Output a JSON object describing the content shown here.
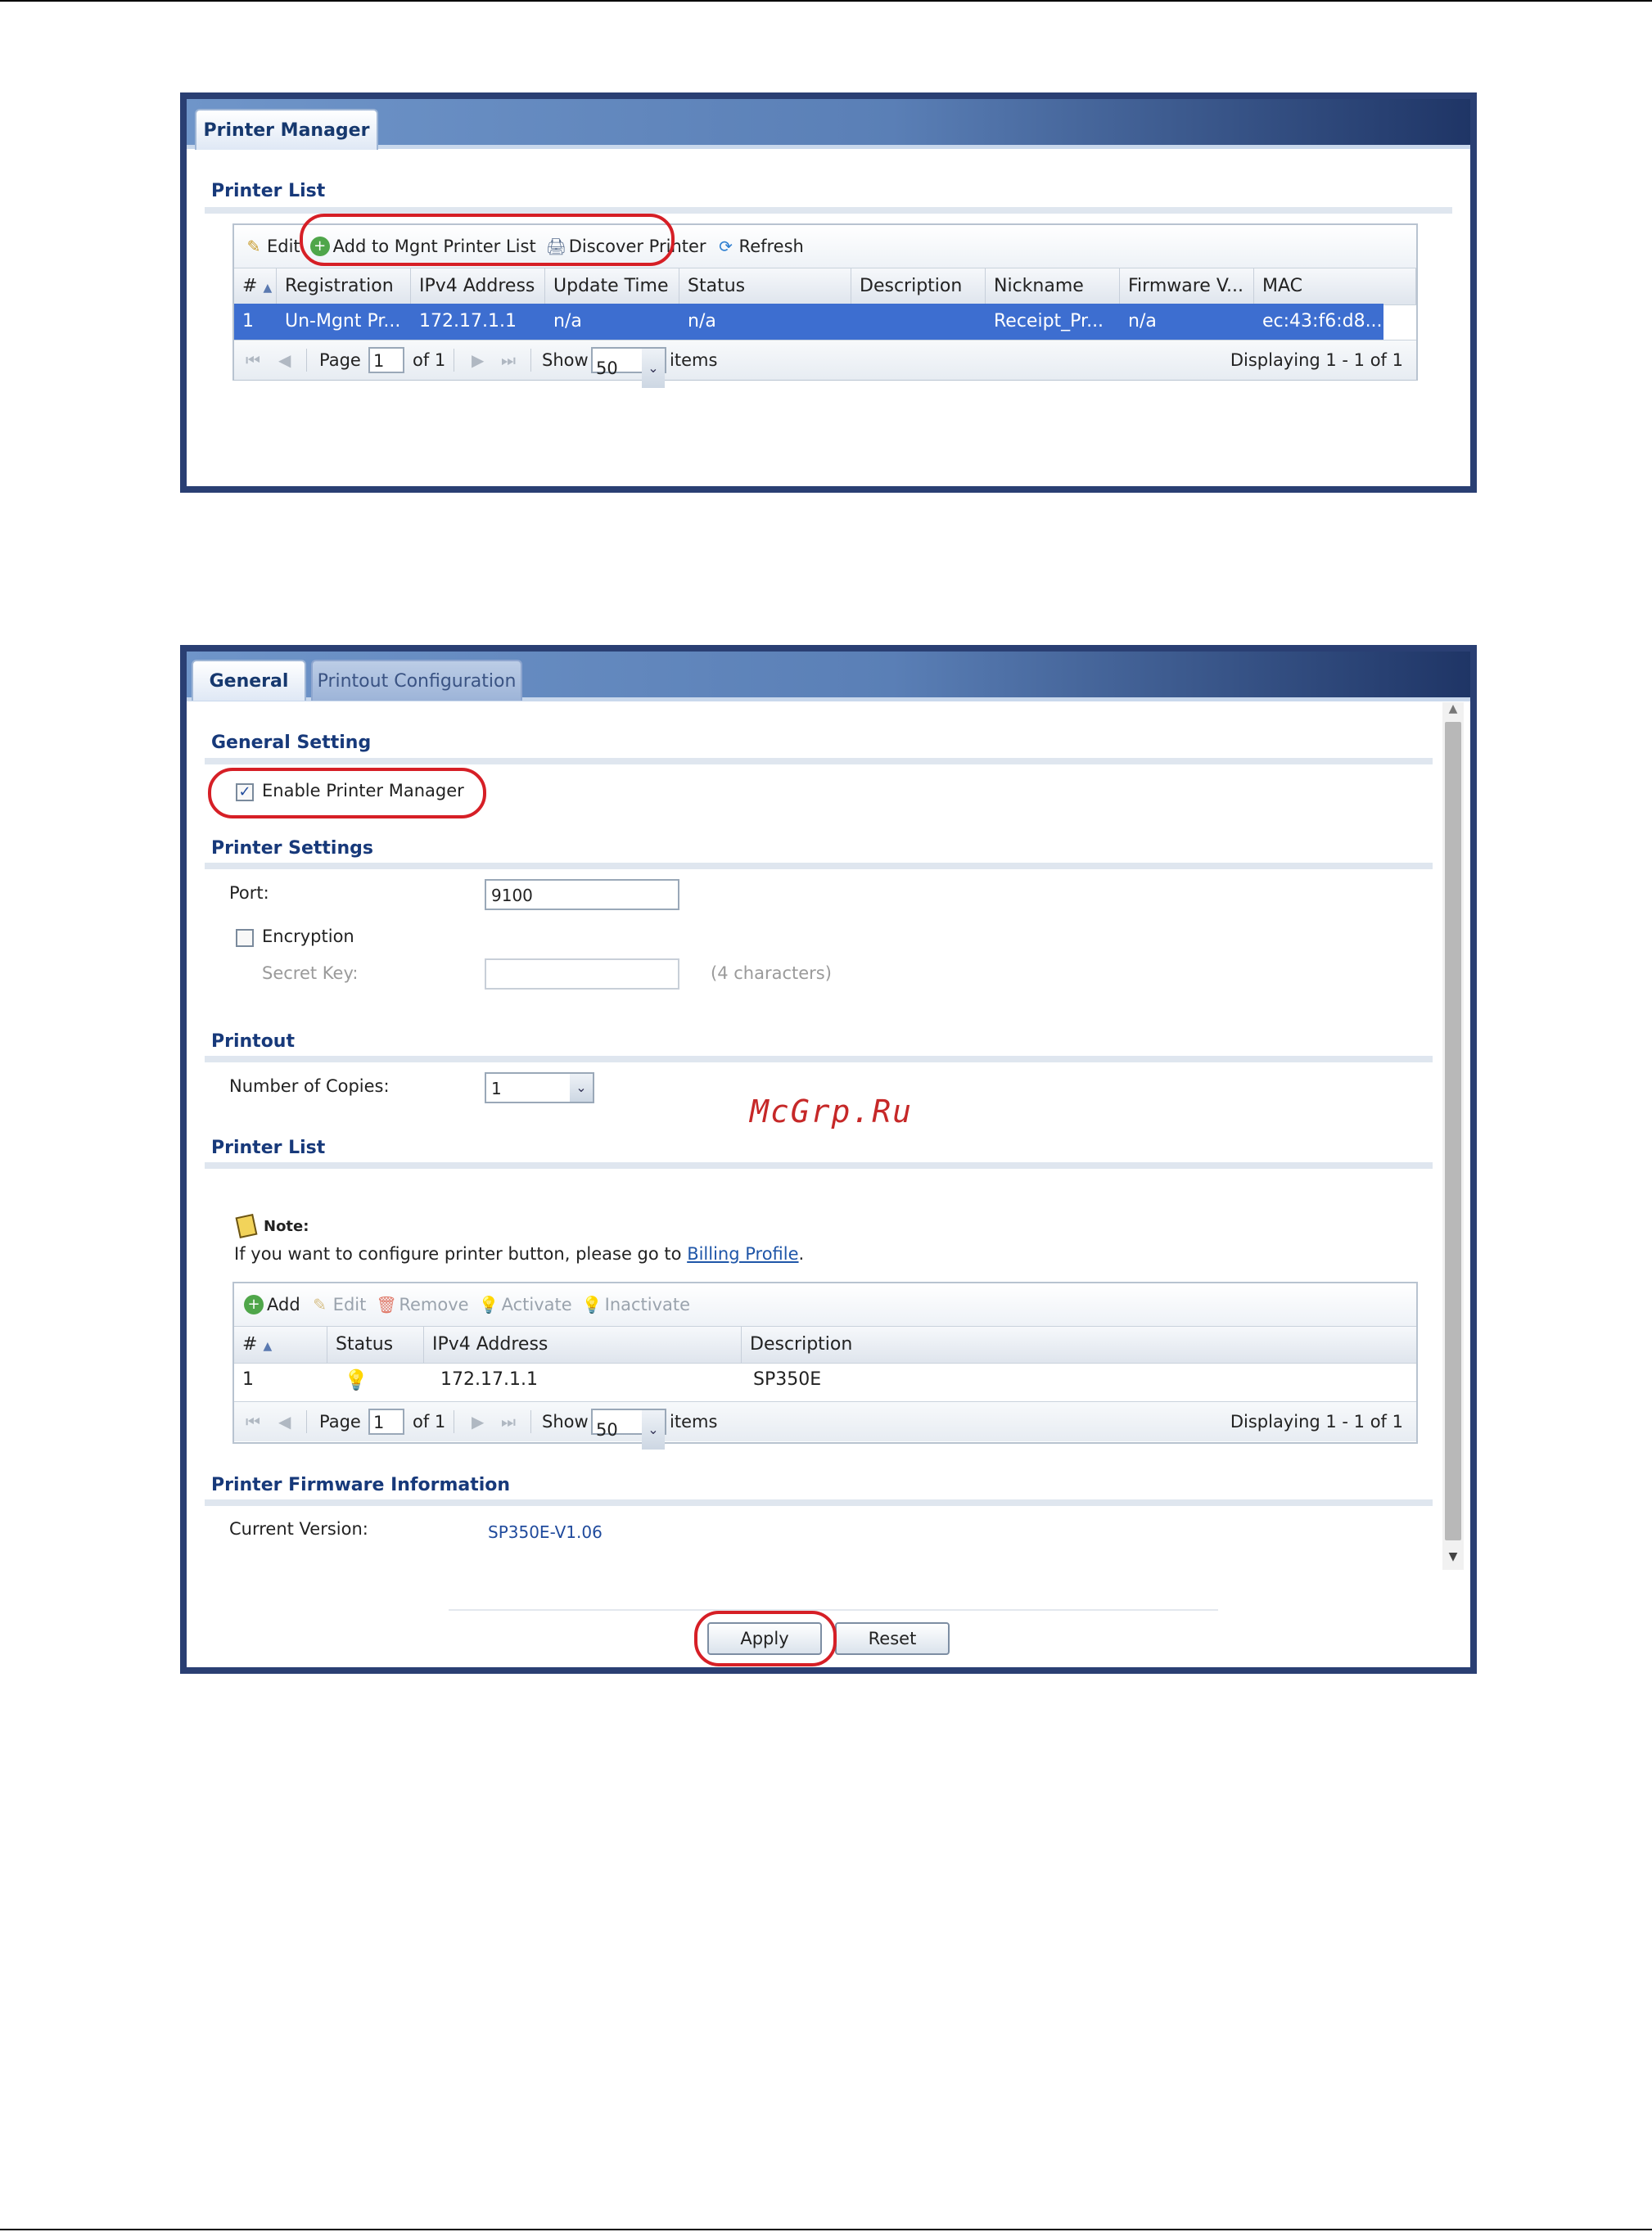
{
  "panel1": {
    "tab_label": "Printer Manager",
    "section_title": "Printer List",
    "toolbar": {
      "edit": "Edit",
      "add_mgnt": "Add to Mgnt Printer List",
      "discover": "Discover Printer",
      "refresh": "Refresh"
    },
    "columns": [
      "#",
      "Registration",
      "IPv4 Address",
      "Update Time",
      "Status",
      "Description",
      "Nickname",
      "Firmware V...",
      "MAC"
    ],
    "rows": [
      [
        "1",
        "Un-Mgnt Pr...",
        "172.17.1.1",
        "n/a",
        "n/a",
        "",
        "Receipt_Pr...",
        "n/a",
        "ec:43:f6:d8..."
      ]
    ],
    "pager": {
      "page_label": "Page",
      "page_value": "1",
      "of_label": "of 1",
      "show_label": "Show",
      "show_value": "50",
      "items_label": "items",
      "displaying": "Displaying 1 - 1 of 1"
    }
  },
  "panel2": {
    "tabs": [
      "General",
      "Printout Configuration"
    ],
    "general_setting": {
      "title": "General Setting",
      "enable_label": "Enable Printer Manager",
      "enable_checked": true
    },
    "printer_settings": {
      "title": "Printer Settings",
      "port_label": "Port:",
      "port_value": "9100",
      "encryption_label": "Encryption",
      "secret_key_label": "Secret Key:",
      "secret_hint": "(4 characters)"
    },
    "printout": {
      "title": "Printout",
      "copies_label": "Number of Copies:",
      "copies_value": "1"
    },
    "printer_list": {
      "title": "Printer List",
      "note_label": "Note:",
      "note_text": "If you want to configure printer button, please go to",
      "note_link": "Billing Profile",
      "note_end": ".",
      "toolbar": {
        "add": "Add",
        "edit": "Edit",
        "remove": "Remove",
        "activate": "Activate",
        "inactivate": "Inactivate"
      },
      "columns": [
        "#",
        "Status",
        "IPv4 Address",
        "Description"
      ],
      "rows": [
        [
          "1",
          "",
          "172.17.1.1",
          "SP350E"
        ]
      ],
      "pager": {
        "page_label": "Page",
        "page_value": "1",
        "of_label": "of 1",
        "show_label": "Show",
        "show_value": "50",
        "items_label": "items",
        "displaying": "Displaying 1 - 1 of 1"
      }
    },
    "firmware": {
      "title": "Printer Firmware Information",
      "version_label": "Current Version:",
      "version_value": "SP350E-V1.06"
    },
    "buttons": {
      "apply": "Apply",
      "reset": "Reset"
    }
  },
  "watermark": "McGrp.Ru",
  "colors": {
    "accent_red": "#d61f26",
    "header_blue": "#2a3f73",
    "selection_blue": "#3d6ed0",
    "title_blue": "#17397a"
  }
}
